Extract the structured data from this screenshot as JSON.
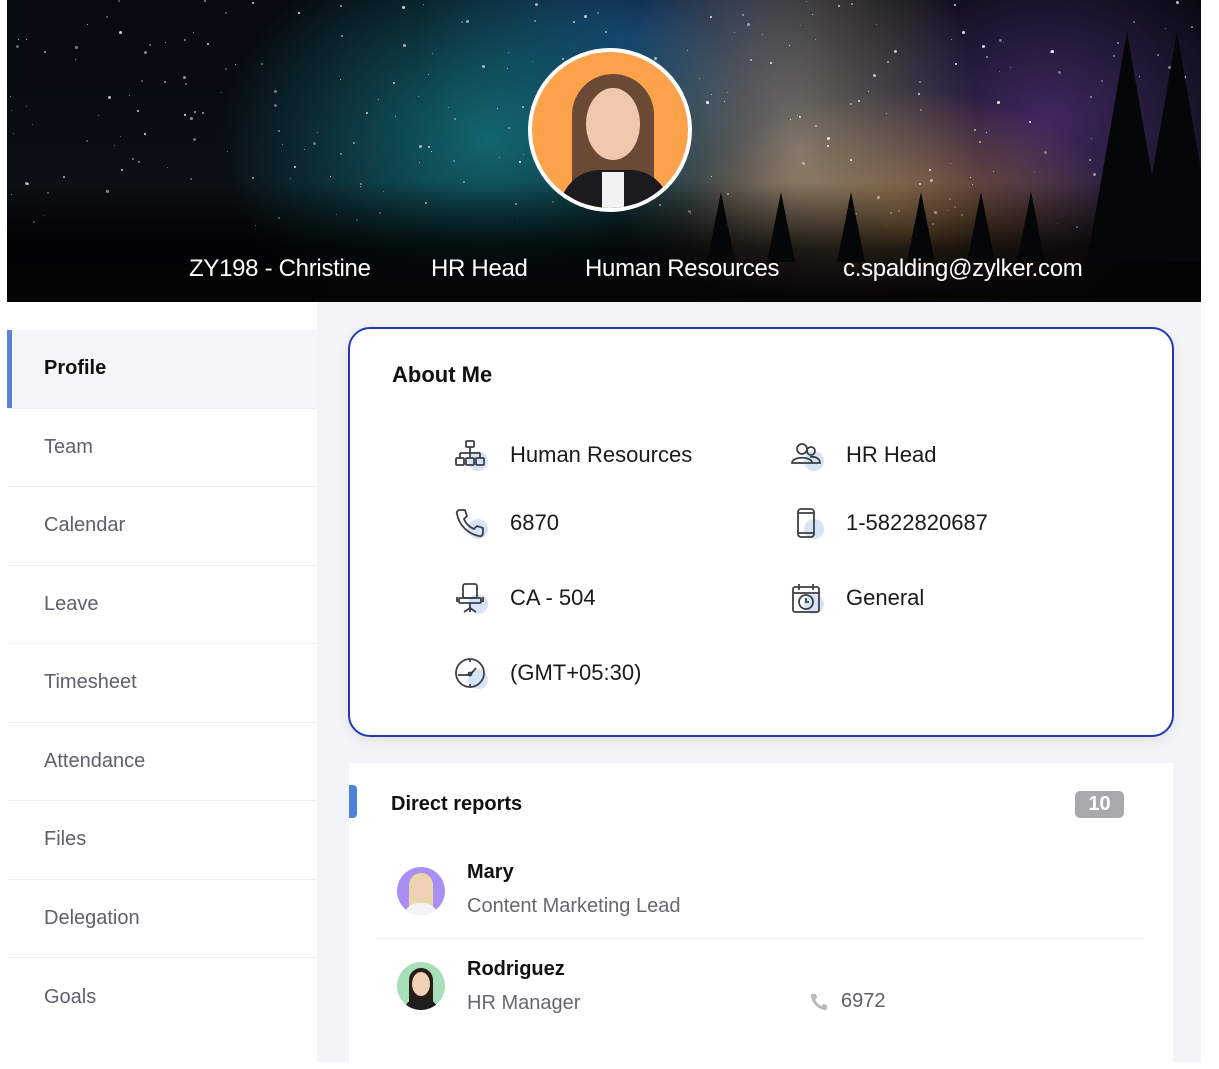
{
  "banner": {
    "employee_id_name": "ZY198 - Christine",
    "designation": "HR Head",
    "department": "Human Resources",
    "email": "c.spalding@zylker.com",
    "avatar_icon": "profile-photo",
    "avatar_bg_color": "#fba24a"
  },
  "sidebar": {
    "accent_color": "#5b84d6",
    "items": [
      {
        "label": "Profile",
        "active": true
      },
      {
        "label": "Team",
        "active": false
      },
      {
        "label": "Calendar",
        "active": false
      },
      {
        "label": "Leave",
        "active": false
      },
      {
        "label": "Timesheet",
        "active": false
      },
      {
        "label": "Attendance",
        "active": false
      },
      {
        "label": "Files",
        "active": false
      },
      {
        "label": "Delegation",
        "active": false
      },
      {
        "label": "Goals",
        "active": false
      }
    ]
  },
  "about_me": {
    "title": "About Me",
    "border_color": "#1f3bb3",
    "fields": {
      "department": {
        "icon": "org-chart-icon",
        "value": "Human Resources"
      },
      "designation": {
        "icon": "users-icon",
        "value": "HR Head"
      },
      "extension": {
        "icon": "phone-icon",
        "value": "6870"
      },
      "mobile": {
        "icon": "mobile-icon",
        "value": "1-5822820687"
      },
      "seating": {
        "icon": "chair-icon",
        "value": "CA - 504"
      },
      "shift": {
        "icon": "calendar-clock-icon",
        "value": "General"
      },
      "timezone": {
        "icon": "clock-icon",
        "value": "(GMT+05:30)"
      }
    }
  },
  "direct_reports": {
    "title": "Direct reports",
    "count": "10",
    "items": [
      {
        "name": "Mary",
        "role": "Content Marketing Lead",
        "phone": "",
        "avatar_bg": "#a98ef5"
      },
      {
        "name": "Rodriguez",
        "role": "HR Manager",
        "phone": "6972",
        "avatar_bg": "#a6dfb9"
      }
    ]
  }
}
